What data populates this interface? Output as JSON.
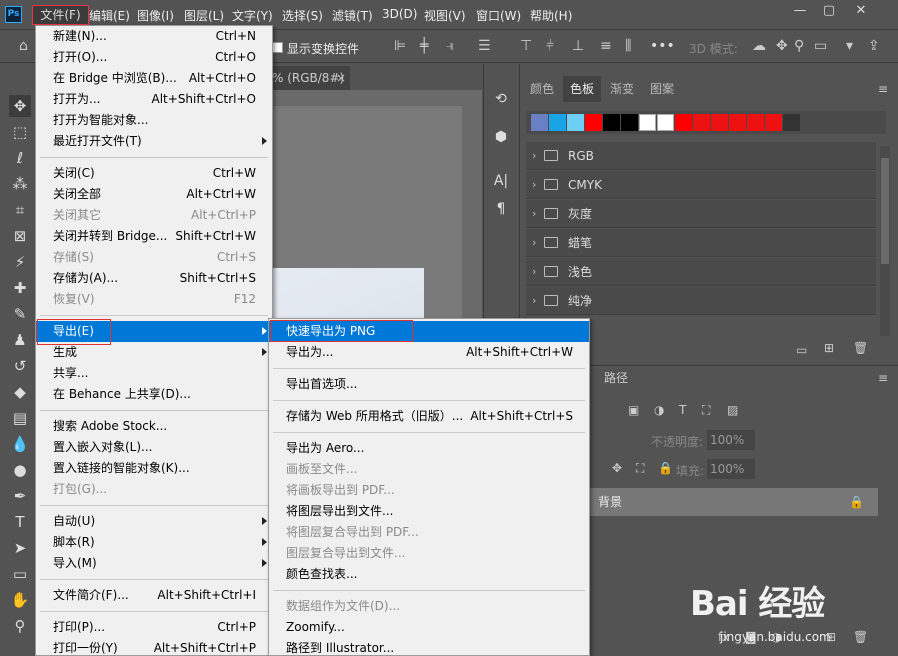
{
  "app": {
    "logo": "Ps"
  },
  "menubar": {
    "items": [
      "文件(F)",
      "编辑(E)",
      "图像(I)",
      "图层(L)",
      "文字(Y)",
      "选择(S)",
      "滤镜(T)",
      "3D(D)",
      "视图(V)",
      "窗口(W)",
      "帮助(H)"
    ]
  },
  "window_controls": [
    "minimize-icon",
    "restore-icon",
    "close-icon"
  ],
  "options_bar": {
    "show_transform_controls": "显示变换控件",
    "mode_3d": "3D 模式:",
    "more": "•••"
  },
  "document": {
    "tab_title": "% (RGB/8#)",
    "tab_close": "×"
  },
  "swatches_panel": {
    "tabs": [
      "颜色",
      "色板",
      "渐变",
      "图案"
    ],
    "active_tab": "色板",
    "recent_swatches": [
      "#6b7fc4",
      "#1aa3e6",
      "#6ecff6",
      "#ff0000",
      "#000000",
      "#000000",
      "#ffffff",
      "#ffffff",
      "#ff0000",
      "#ee1111",
      "#ee1111",
      "#ee1111",
      "#ee1111",
      "#ee1111",
      "#333333"
    ],
    "groups": [
      "RGB",
      "CMYK",
      "灰度",
      "蜡笔",
      "浅色",
      "纯净"
    ]
  },
  "layers_panel": {
    "tab": "路径",
    "opacity_label": "不透明度:",
    "opacity_value": "100%",
    "fill_label": "填充:",
    "fill_value": "100%",
    "background_layer": "背景"
  },
  "file_menu": {
    "items": [
      {
        "label": "新建(N)...",
        "shortcut": "Ctrl+N",
        "disabled": false
      },
      {
        "label": "打开(O)...",
        "shortcut": "Ctrl+O",
        "disabled": false
      },
      {
        "label": "在 Bridge 中浏览(B)...",
        "shortcut": "Alt+Ctrl+O",
        "disabled": false
      },
      {
        "label": "打开为...",
        "shortcut": "Alt+Shift+Ctrl+O",
        "disabled": false
      },
      {
        "label": "打开为智能对象...",
        "shortcut": "",
        "disabled": false
      },
      {
        "label": "最近打开文件(T)",
        "shortcut": "",
        "disabled": false,
        "submenu": true
      },
      {
        "separator": true
      },
      {
        "label": "关闭(C)",
        "shortcut": "Ctrl+W",
        "disabled": false
      },
      {
        "label": "关闭全部",
        "shortcut": "Alt+Ctrl+W",
        "disabled": false
      },
      {
        "label": "关闭其它",
        "shortcut": "Alt+Ctrl+P",
        "disabled": true
      },
      {
        "label": "关闭并转到 Bridge...",
        "shortcut": "Shift+Ctrl+W",
        "disabled": false
      },
      {
        "label": "存储(S)",
        "shortcut": "Ctrl+S",
        "disabled": true
      },
      {
        "label": "存储为(A)...",
        "shortcut": "Shift+Ctrl+S",
        "disabled": false
      },
      {
        "label": "恢复(V)",
        "shortcut": "F12",
        "disabled": true
      },
      {
        "separator": true
      },
      {
        "label": "导出(E)",
        "shortcut": "",
        "disabled": false,
        "submenu": true,
        "highlighted": true
      },
      {
        "label": "生成",
        "shortcut": "",
        "disabled": false,
        "submenu": true
      },
      {
        "label": "共享...",
        "shortcut": "",
        "disabled": false
      },
      {
        "label": "在 Behance 上共享(D)...",
        "shortcut": "",
        "disabled": false
      },
      {
        "separator": true
      },
      {
        "label": "搜索 Adobe Stock...",
        "shortcut": "",
        "disabled": false
      },
      {
        "label": "置入嵌入对象(L)...",
        "shortcut": "",
        "disabled": false
      },
      {
        "label": "置入链接的智能对象(K)...",
        "shortcut": "",
        "disabled": false
      },
      {
        "label": "打包(G)...",
        "shortcut": "",
        "disabled": true
      },
      {
        "separator": true
      },
      {
        "label": "自动(U)",
        "shortcut": "",
        "disabled": false,
        "submenu": true
      },
      {
        "label": "脚本(R)",
        "shortcut": "",
        "disabled": false,
        "submenu": true
      },
      {
        "label": "导入(M)",
        "shortcut": "",
        "disabled": false,
        "submenu": true
      },
      {
        "separator": true
      },
      {
        "label": "文件简介(F)...",
        "shortcut": "Alt+Shift+Ctrl+I",
        "disabled": false
      },
      {
        "separator": true
      },
      {
        "label": "打印(P)...",
        "shortcut": "Ctrl+P",
        "disabled": false
      },
      {
        "label": "打印一份(Y)",
        "shortcut": "Alt+Shift+Ctrl+P",
        "disabled": false
      }
    ]
  },
  "export_menu": {
    "items": [
      {
        "label": "快速导出为 PNG",
        "shortcut": "",
        "disabled": false,
        "highlighted": true
      },
      {
        "label": "导出为...",
        "shortcut": "Alt+Shift+Ctrl+W",
        "disabled": false
      },
      {
        "separator": true
      },
      {
        "label": "导出首选项...",
        "shortcut": "",
        "disabled": false
      },
      {
        "separator": true
      },
      {
        "label": "存储为 Web 所用格式（旧版）...",
        "shortcut": "Alt+Shift+Ctrl+S",
        "disabled": false
      },
      {
        "separator": true
      },
      {
        "label": "导出为 Aero...",
        "shortcut": "",
        "disabled": false
      },
      {
        "label": "画板至文件...",
        "shortcut": "",
        "disabled": true
      },
      {
        "label": "将画板导出到 PDF...",
        "shortcut": "",
        "disabled": true
      },
      {
        "label": "将图层导出到文件...",
        "shortcut": "",
        "disabled": false
      },
      {
        "label": "将图层复合导出到 PDF...",
        "shortcut": "",
        "disabled": true
      },
      {
        "label": "图层复合导出到文件...",
        "shortcut": "",
        "disabled": true
      },
      {
        "label": "颜色查找表...",
        "shortcut": "",
        "disabled": false
      },
      {
        "separator": true
      },
      {
        "label": "数据组作为文件(D)...",
        "shortcut": "",
        "disabled": true
      },
      {
        "label": "Zoomify...",
        "shortcut": "",
        "disabled": false
      },
      {
        "label": "路径到 Illustrator...",
        "shortcut": "",
        "disabled": false
      }
    ]
  },
  "watermark": {
    "brand": "Bai 经验",
    "url": "jingyan.baidu.com"
  }
}
